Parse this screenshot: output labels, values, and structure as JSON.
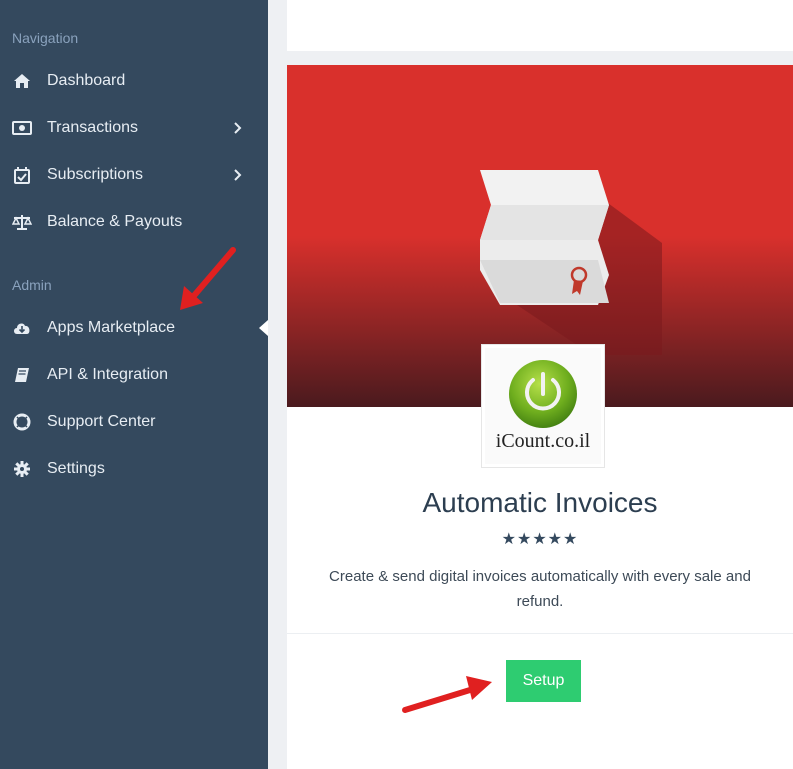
{
  "sidebar": {
    "navigation_label": "Navigation",
    "admin_label": "Admin",
    "items": [
      {
        "label": "Dashboard",
        "icon": "home-icon"
      },
      {
        "label": "Transactions",
        "icon": "money-icon",
        "has_submenu": true
      },
      {
        "label": "Subscriptions",
        "icon": "calendar-check-icon",
        "has_submenu": true
      },
      {
        "label": "Balance & Payouts",
        "icon": "balance-scale-icon"
      },
      {
        "label": "Apps Marketplace",
        "icon": "cloud-download-icon",
        "active": true
      },
      {
        "label": "API & Integration",
        "icon": "book-icon"
      },
      {
        "label": "Support Center",
        "icon": "life-ring-icon"
      },
      {
        "label": "Settings",
        "icon": "gear-icon"
      }
    ]
  },
  "app": {
    "logo_text": "iCount.co.il",
    "title": "Automatic Invoices",
    "rating": "★★★★★",
    "description": "Create & send digital invoices automatically with every sale and refund.",
    "setup_label": "Setup"
  },
  "colors": {
    "sidebar_bg": "#34495e",
    "hero_red": "#d9302c",
    "setup_green": "#2ecc71",
    "annotation_arrow": "#e02020"
  }
}
